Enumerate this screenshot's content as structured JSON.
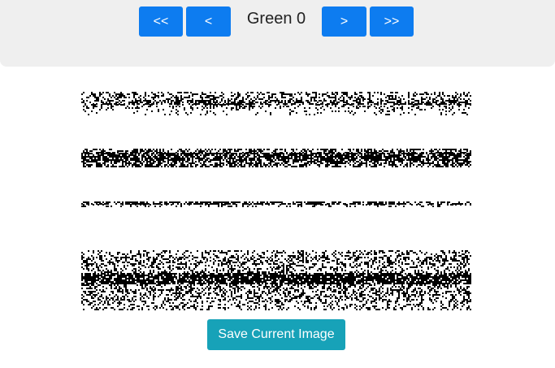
{
  "nav": {
    "first_label": "<<",
    "prev_label": "<",
    "title": "Green 0",
    "next_label": ">",
    "last_label": ">>"
  },
  "actions": {
    "save_label": "Save Current Image"
  },
  "colors": {
    "nav_button": "#0d7cf0",
    "save_button": "#17a2b8",
    "topbar_bg": "#efefef",
    "pixel": "#000000"
  }
}
